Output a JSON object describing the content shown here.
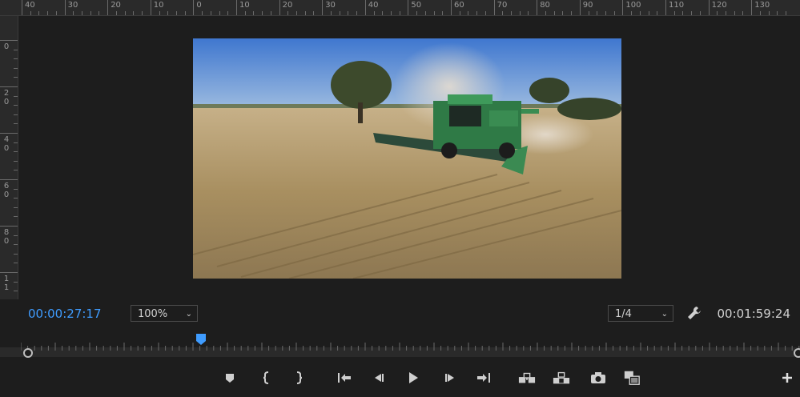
{
  "ruler": {
    "horizontal_labels": [
      "40",
      "30",
      "20",
      "10",
      "0",
      "10",
      "20",
      "30",
      "40",
      "50",
      "60",
      "70",
      "80",
      "90",
      "100",
      "110",
      "120",
      "130"
    ],
    "vertical_labels": [
      [
        "0"
      ],
      [
        "2",
        "0"
      ],
      [
        "4",
        "0"
      ],
      [
        "6",
        "0"
      ],
      [
        "8",
        "0"
      ],
      [
        "1",
        "1"
      ]
    ]
  },
  "controls": {
    "current_timecode": "00:00:27:17",
    "zoom_level": "100%",
    "resolution": "1/4",
    "duration_timecode": "00:01:59:24"
  },
  "timeline": {
    "playhead_position_fraction": 0.231
  },
  "transport": {
    "buttons": [
      "add-marker",
      "mark-in",
      "mark-out",
      "go-to-in",
      "step-back",
      "play",
      "step-forward",
      "go-to-out",
      "insert",
      "overwrite",
      "export-frame",
      "comparison-view",
      "add-button"
    ]
  },
  "colors": {
    "accent": "#3f9cff",
    "background": "#1d1d1d",
    "ruler": "#2a2a2a"
  }
}
